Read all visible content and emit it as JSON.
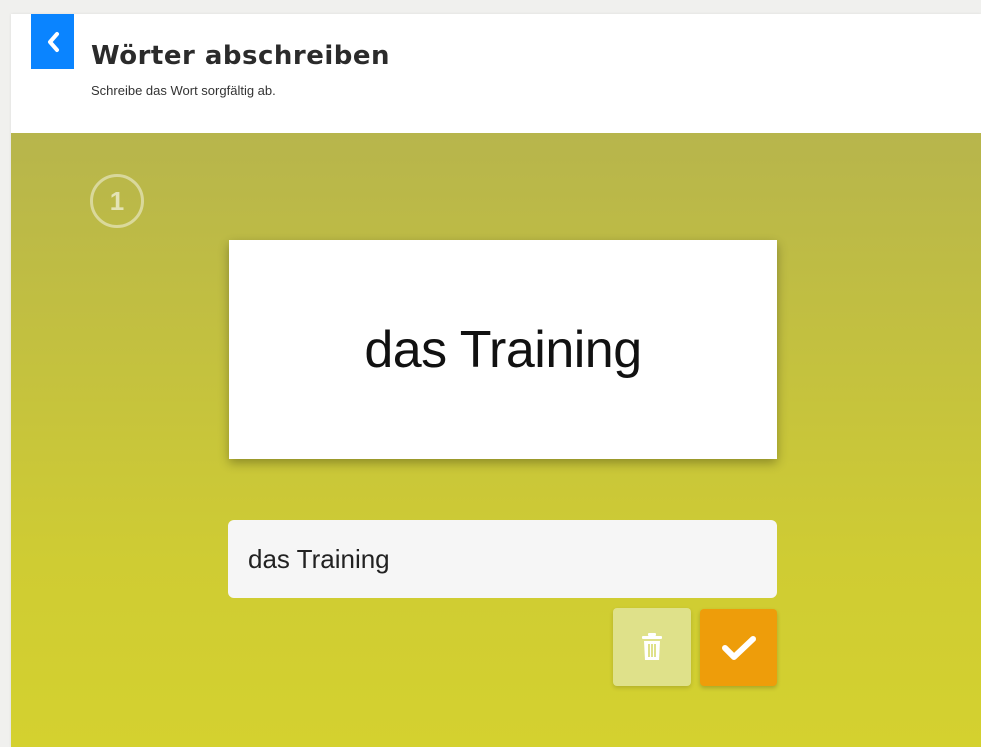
{
  "header": {
    "title": "Wörter abschreiben",
    "subtitle": "Schreibe das Wort sorgfältig ab.",
    "back_icon": "chevron-left-icon"
  },
  "exercise": {
    "step_number": "1",
    "word": "das Training",
    "answer_value": "das Training"
  },
  "actions": {
    "delete_icon": "trash-icon",
    "check_icon": "checkmark-icon"
  },
  "colors": {
    "back_button": "#0a84ff",
    "stage_top": "#b7b54c",
    "stage_bottom": "#d4d12f",
    "delete_button": "#dfe18a",
    "check_button": "#ee9d0a"
  }
}
